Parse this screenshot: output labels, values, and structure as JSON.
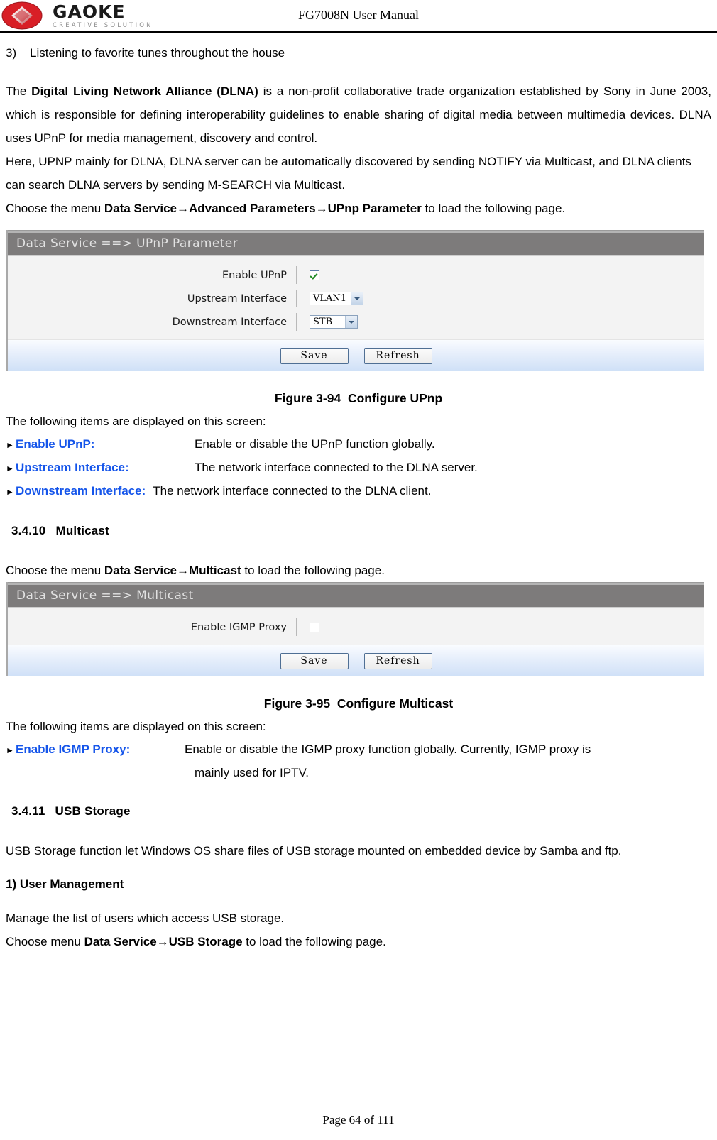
{
  "header": {
    "logo_name": "GAOKE",
    "logo_tagline": "CREATIVE SOLUTION",
    "title": "FG7008N User Manual"
  },
  "content": {
    "list_item_number": "3)",
    "list_item_text": "Listening to favorite tunes throughout the house",
    "dlna_para_pre": "The ",
    "dlna_para_bold": "Digital Living Network Alliance (DLNA)",
    "dlna_para_post": " is a non-profit collaborative trade organization established by Sony in June 2003, which is responsible for defining interoperability guidelines to enable sharing of digital media between multimedia devices. DLNA uses UPnP for media management, discovery and control.",
    "upnp_para": "Here, UPNP mainly for DLNA, DLNA server can be automatically discovered by sending NOTIFY via Multicast, and DLNA clients can search DLNA servers by sending M-SEARCH via Multicast.",
    "choose_menu_1_pre": "Choose the menu ",
    "choose_menu_1_path": "Data Service→Advanced Parameters→UPnp Parameter",
    "choose_menu_1_post": " to load the following page.",
    "items_intro": "The following items are displayed on this screen:",
    "choose_menu_2_pre": "Choose the menu ",
    "choose_menu_2_path": "Data Service→Multicast",
    "choose_menu_2_post": " to load the following page.",
    "usb_para": "USB Storage function let Windows OS share files of USB storage mounted on embedded device by Samba and ftp.",
    "user_mgmt_head": "1) User Management",
    "user_mgmt_para": "Manage the list of users which access USB storage.",
    "choose_menu_3_pre": "Choose menu ",
    "choose_menu_3_path": "Data Service→USB Storage",
    "choose_menu_3_post": " to load the following page."
  },
  "upnp_panel": {
    "titlebar": "Data Service ==> UPnP Parameter",
    "rows": [
      {
        "label": "Enable UPnP",
        "type": "checkbox",
        "checked": true
      },
      {
        "label": "Upstream Interface",
        "type": "select",
        "value": "VLAN1"
      },
      {
        "label": "Downstream Interface",
        "type": "select",
        "value": "STB"
      }
    ],
    "save_label": "Save",
    "refresh_label": "Refresh"
  },
  "figure_94": {
    "number": "Figure 3-94",
    "title": "Configure UPnp"
  },
  "upnp_items": [
    {
      "term": "Enable UPnP:",
      "desc": "Enable or disable the UPnP function globally."
    },
    {
      "term": "Upstream Interface:",
      "desc": "The network interface connected to the DLNA server."
    },
    {
      "term": "Downstream Interface:",
      "desc": "The network interface connected to the DLNA client."
    }
  ],
  "section_3410": {
    "number": "3.4.10",
    "title": "Multicast"
  },
  "multicast_panel": {
    "titlebar": "Data Service ==> Multicast",
    "rows": [
      {
        "label": "Enable IGMP Proxy",
        "type": "checkbox",
        "checked": false
      }
    ],
    "save_label": "Save",
    "refresh_label": "Refresh"
  },
  "figure_95": {
    "number": "Figure 3-95",
    "title": "Configure Multicast"
  },
  "multicast_items": [
    {
      "term": "Enable IGMP Proxy:",
      "desc": "Enable or disable the IGMP proxy function globally. Currently, IGMP proxy is",
      "desc_cont": "mainly used for IPTV."
    }
  ],
  "section_3411": {
    "number": "3.4.11",
    "title": "USB Storage"
  },
  "footer": {
    "page_label": "Page 64 of 111"
  },
  "colors": {
    "brand_red": "#d81f26",
    "link_blue": "#1555ea",
    "panel_header_gray": "#7d7b7b",
    "panel_body_gray": "#f3f3f3"
  }
}
